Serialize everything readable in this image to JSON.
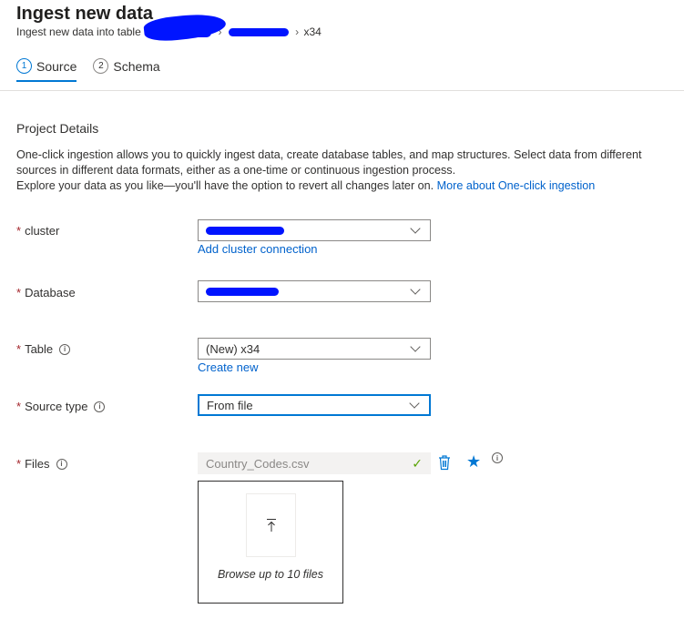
{
  "header": {
    "title": "Ingest new data",
    "breadcrumb_prefix": "Ingest new data into table",
    "breadcrumb_table": "x34"
  },
  "tabs": [
    {
      "number": "1",
      "label": "Source",
      "active": true
    },
    {
      "number": "2",
      "label": "Schema",
      "active": false
    }
  ],
  "section": {
    "title": "Project Details",
    "description_line1": "One-click ingestion allows you to quickly ingest data, create database tables, and map structures. Select data from different sources in different data formats, either as a one-time or continuous ingestion process.",
    "description_line2": "Explore your data as you like—you'll have the option to revert all changes later on.",
    "more_link": "More about One-click ingestion"
  },
  "form": {
    "required_mark": "*",
    "cluster": {
      "label": "cluster",
      "link": "Add cluster connection"
    },
    "database": {
      "label": "Database"
    },
    "table": {
      "label": "Table",
      "value": "(New) x34",
      "link": "Create new"
    },
    "source_type": {
      "label": "Source type",
      "value": "From file"
    },
    "files": {
      "label": "Files",
      "value": "Country_Codes.csv",
      "browse_text": "Browse up to 10 files"
    }
  },
  "icons": {
    "info": "info-icon",
    "chevron": "chevron-down-icon",
    "check": "checkmark-icon",
    "trash": "trash-icon",
    "star": "star-icon",
    "upload": "upload-icon"
  },
  "colors": {
    "accent": "#0078d4",
    "link": "#0062cc",
    "required": "#a4262c",
    "success": "#57a300",
    "redaction": "#0014ff"
  }
}
